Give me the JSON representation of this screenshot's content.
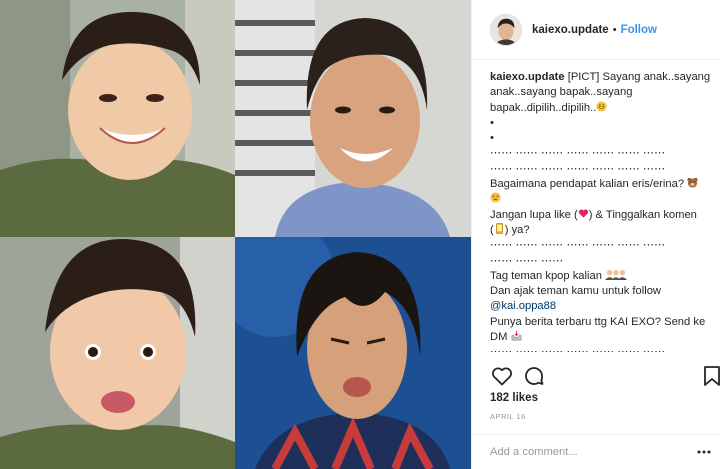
{
  "post": {
    "username": "kaiexo.update",
    "separator": "•",
    "follow_label": "Follow"
  },
  "caption": {
    "username": "kaiexo.update",
    "line1_rest": " [PICT] Sayang anak..sayang",
    "line2": "anak..sayang bapak..sayang",
    "line3": "bapak..dipilih..dipilih..",
    "bullet1": "•",
    "bullet2": "•",
    "sep1": "⋯⋯ ⋯⋯ ⋯⋯ ⋯⋯ ⋯⋯ ⋯⋯ ⋯⋯",
    "sep2": "⋯⋯ ⋯⋯ ⋯⋯ ⋯⋯ ⋯⋯ ⋯⋯ ⋯⋯",
    "question": "Bagaimana pendapat kalian eris/erina?",
    "like_line_a": "Jangan lupa like (",
    "like_line_b": ") & Tinggalkan komen",
    "like_line_c": "(",
    "like_line_d": ") ya?",
    "sep3": "⋯⋯ ⋯⋯ ⋯⋯ ⋯⋯ ⋯⋯ ⋯⋯ ⋯⋯",
    "sep4": "⋯⋯ ⋯⋯ ⋯⋯",
    "tag_line": "Tag teman kpop kalian",
    "invite_line": "Dan ajak teman kamu untuk follow",
    "mention": "@kai.oppa88",
    "news_line": "Punya berita terbaru ttg KAI EXO? Send ke",
    "dm_line": "DM",
    "sep5": "⋯⋯ ⋯⋯ ⋯⋯ ⋯⋯ ⋯⋯ ⋯⋯ ⋯⋯",
    "sep6": "⋯⋯ ⋯⋯ ⋯⋯"
  },
  "icons": {
    "like": "heart-outline-icon",
    "comment": "speech-bubble-icon",
    "save": "bookmark-icon",
    "more": "ellipsis-icon"
  },
  "stats": {
    "likes": "182 likes",
    "date": "APRIL 16"
  },
  "comment": {
    "placeholder": "Add a comment..."
  },
  "colors": {
    "link": "#3897f0",
    "mention": "#003569",
    "muted": "#999999"
  }
}
